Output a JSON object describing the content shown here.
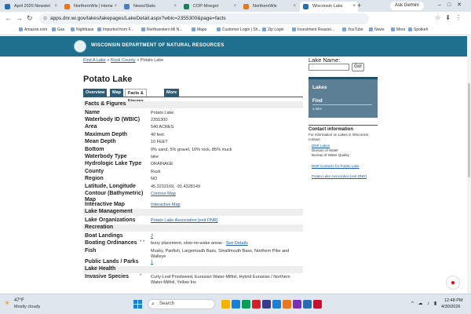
{
  "browser": {
    "tabs": [
      {
        "label": "April 2026 Newslet",
        "color": "#2b6cb0"
      },
      {
        "label": "NorthernWis | Home",
        "color": "#e87722"
      },
      {
        "label": "News/Stats",
        "color": "#4a7fc1"
      },
      {
        "label": "COP-Mnegot",
        "color": "#1a7f5a"
      },
      {
        "label": "NorthernWis",
        "color": "#e87722"
      },
      {
        "label": "Wisconsin Lake",
        "color": "#2b6cb0"
      }
    ],
    "new_tab": "+",
    "ask_gemini": "Ask Gemini",
    "url": "apps.dnr.wi.gov/lakes/lakepages/LakeDetail.aspx?wbic=2355300&page=facts",
    "bookmarks": [
      "Amazon.com",
      "Gas",
      "Nightbase",
      "Imported from F...",
      "Northwestern Mi N...",
      "Maps",
      "Customer Login | Sh...",
      "Zip Login",
      "Investment Reason...",
      "YouTube",
      "News",
      "More",
      "Spotkeh"
    ]
  },
  "header": {
    "agency": "WISCONSIN DEPARTMENT OF NATURAL RESOURCES"
  },
  "breadcrumb": {
    "find": "Find A Lake",
    "sep1": ">",
    "county": "Rusk County",
    "sep2": ">",
    "current": "Potato Lake"
  },
  "page": {
    "title": "Potato Lake",
    "tabs": [
      "Overview",
      "Map",
      "Facts & Figures",
      "More"
    ]
  },
  "facts": {
    "rows": [
      {
        "type": "section",
        "label": "Facts & Figures"
      },
      {
        "label": "Name",
        "value": "Potato Lake"
      },
      {
        "label": "Waterbody ID (WBIC)",
        "value": "2355300"
      },
      {
        "label": "Area",
        "value": "540 ACRES"
      },
      {
        "label": "Maximum Depth",
        "value": "40 feet"
      },
      {
        "label": "Mean Depth",
        "value": "10 FEET"
      },
      {
        "label": "Bottom",
        "value": "0% sand, 5% gravel, 10% rock, 85% muck"
      },
      {
        "label": "Waterbody Type",
        "value": "lake"
      },
      {
        "label": "Hydrologic Lake Type",
        "value": "DRAINAGE"
      },
      {
        "label": "County",
        "value": "Rusk"
      },
      {
        "label": "Region",
        "value": "NO"
      },
      {
        "label": "Latitude, Longitude",
        "value": "45.3232169, -91.4328149"
      },
      {
        "label": "Contour (Bathymetric) Map",
        "value": "Contour Map",
        "link": true
      },
      {
        "label": "Interactive Map",
        "value": "Interactive Map",
        "link": true
      },
      {
        "type": "section",
        "label": "Lake Management"
      },
      {
        "label": "Lake Organizations",
        "value": "Potato Lake Association [exit DNR]",
        "link": true
      },
      {
        "type": "section",
        "label": "Recreation"
      },
      {
        "label": "Boat Landings",
        "value": "2",
        "link": true
      },
      {
        "label": "Boating Ordinances",
        "ast": "* *",
        "value": "buoy placement, slow-no-wake areas -",
        "link_text": "See Details"
      },
      {
        "label": "Fish",
        "value": "Musky, Panfish, Largemouth Bass, Smallmouth Bass, Northern Pike and Walleye"
      },
      {
        "label": "Public Lands / Parks",
        "value": "1",
        "link": true
      },
      {
        "type": "section",
        "label": "Lake Health"
      },
      {
        "label": "Invasive Species",
        "ast": "*",
        "value": "Curly-Leaf Pondweed, Eurasian Water-Milfoil, Hybrid Eurasian / Northern Water-Milfoil, Yellow Iris"
      }
    ]
  },
  "sidebar": {
    "lake_name_label": "Lake Name:",
    "lake_name_value": "",
    "go": "Go!",
    "lakes_title": "Lakes",
    "find": "Find",
    "find_sub": "a lake",
    "contact_title": "Contact information",
    "contact_text": "For information on Lakes in Wisconsin, contact:",
    "dnr_lakes": "DNR Lakes",
    "division": "Division of Water",
    "bureau": "Bureau of Water Quality",
    "dnr_contacts": "DNR Contacts for Potato Lake",
    "association": "Potato Lake Association [exit DNR]"
  },
  "taskbar": {
    "temp": "47°F",
    "weather": "Mostly cloudy",
    "search": "Search",
    "time": "12:48 PM",
    "date": "4/30/2026",
    "apps": [
      "#f2b400",
      "#1b7fd6",
      "#0a9e5a",
      "#d4202a",
      "#3a3a8a",
      "#1b7fd6",
      "#e87722",
      "#7b2fb8",
      "#2b6cb0",
      "#c8102e"
    ]
  }
}
